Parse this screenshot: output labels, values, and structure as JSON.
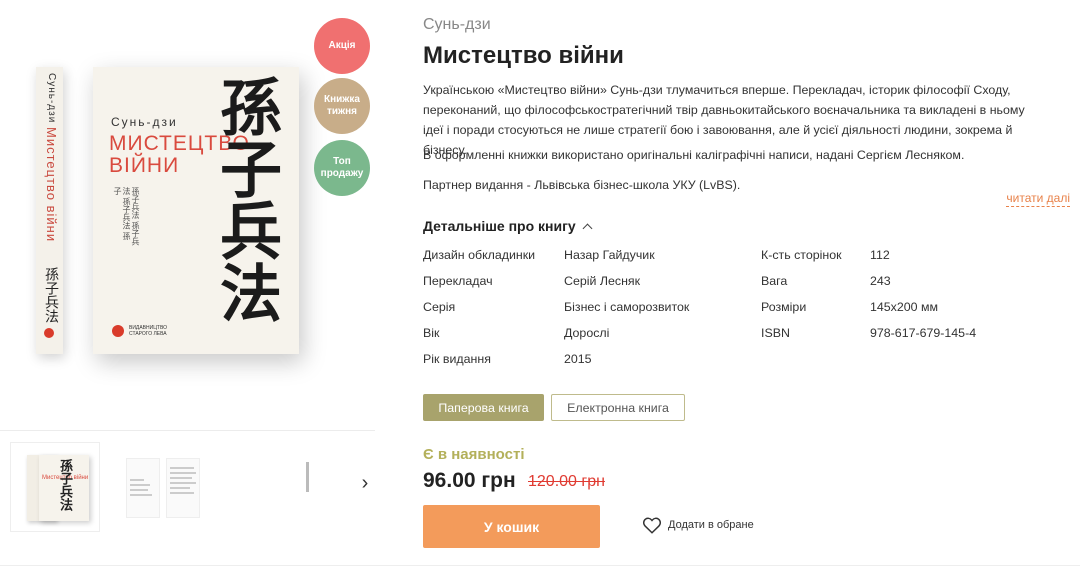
{
  "product": {
    "author": "Сунь-дзи",
    "title": "Мистецтво війни",
    "description": [
      "Українською «Мистецтво війни» Сунь-дзи тлумачиться вперше. Перекладач, історик філософії Сходу, переконаний, що філософськостратегічний твір давньокитайського воєначальника та викладені в ньому ідеї і поради стосуються не лише стратегії бою і завоювання, але й усієї діяльності людини, зокрема й бізнесу.",
      "В оформленні книжки використано оригінальні каліграфічні написи, надані Сергієм Лесняком.",
      "Партнер видання - Львівська бізнес-школа УКУ (LvBS)."
    ],
    "read_more": "читати далі"
  },
  "badges": {
    "sale": "Акція",
    "week": "Книжка тижня",
    "top": "Топ продажу"
  },
  "cover": {
    "author": "Сунь-дзи",
    "title": "Мистецтво війни",
    "calligraphy": "孫子兵法",
    "small_text": "孫子兵法 孫子兵法 孫子兵法 孫子",
    "publisher": "Видавництво Старого Лева"
  },
  "details": {
    "heading": "Детальніше про книгу",
    "left": [
      {
        "label": "Дизайн обкладинки",
        "value": "Назар Гайдучик"
      },
      {
        "label": "Перекладач",
        "value": "Серій Лесняк"
      },
      {
        "label": "Серія",
        "value": "Бізнес і саморозвиток"
      },
      {
        "label": "Вік",
        "value": "Дорослі"
      },
      {
        "label": "Рік видання",
        "value": "2015"
      }
    ],
    "right": [
      {
        "label": "К-сть сторінок",
        "value": "112"
      },
      {
        "label": "Вага",
        "value": "243"
      },
      {
        "label": "Розміри",
        "value": "145х200 мм"
      },
      {
        "label": "ISBN",
        "value": "978-617-679-145-4"
      }
    ]
  },
  "formats": {
    "paper": "Паперова книга",
    "ebook": "Електронна книга"
  },
  "purchase": {
    "stock": "Є в наявності",
    "price": "96.00 грн",
    "old_price": "120.00 грн",
    "cart": "У кошик",
    "favorite": "Додати в обране"
  },
  "colors": {
    "accent_orange": "#f39b5b",
    "stock_olive": "#b3b05a",
    "format_active": "#a8a36c",
    "old_price_red": "#e03b32",
    "badge_sale": "#f07070",
    "badge_week": "#c8ad89",
    "badge_top": "#7bb88d"
  },
  "icons": {
    "details_toggle": "chevron-up-icon",
    "thumbnail_next": "chevron-right-icon",
    "favorite": "heart-icon"
  }
}
